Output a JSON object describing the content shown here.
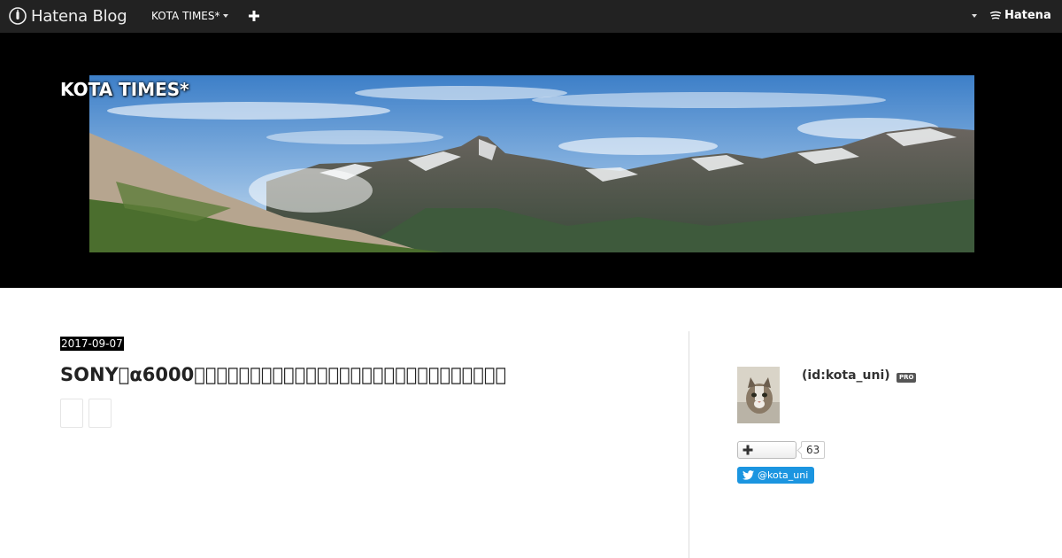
{
  "topbar": {
    "brand": "Hatena Blog",
    "blog_menu": "KOTA TIMES*",
    "service_logo": "Hatena"
  },
  "header": {
    "blog_title": "KOTA TIMES*"
  },
  "entry": {
    "date": "2017-09-07",
    "title": "SONY\u0000α6000\u0000\u0000\u0000\u0000\u0000\u0000\u0000\u0000\u0000\u0000\u0000\u0000\u0000\u0000\u0000\u0000\u0000\u0000\u0000\u0000\u0000\u0000\u0000\u0000\u0000\u0000\u0000\u0000"
  },
  "sidebar": {
    "profile_id": "(id:kota_uni)",
    "pro_badge": "PRO",
    "subscriber_count": "63",
    "twitter_handle": "@kota_uni"
  },
  "colors": {
    "topbar": "#222222",
    "header_bg": "#000000",
    "twitter": "#1b95e0"
  }
}
